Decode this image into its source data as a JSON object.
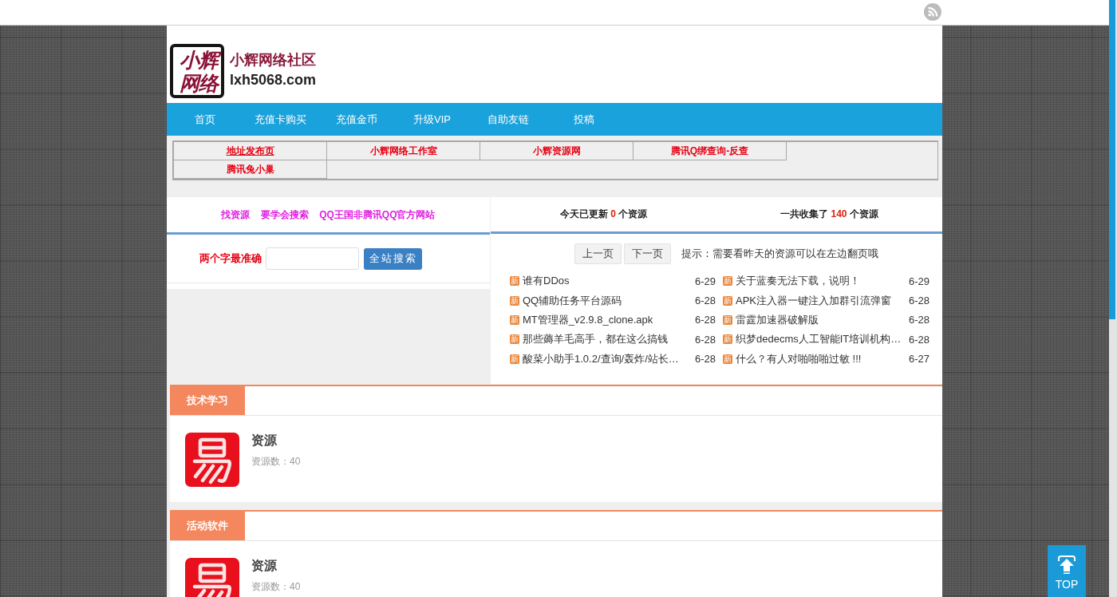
{
  "header": {
    "logo_mark": "小辉网络",
    "site_name": "小辉网络社区",
    "domain": "lxh5068.com"
  },
  "nav": [
    "首页",
    "充值卡购买",
    "充值金币",
    "升级VIP",
    "自助友链",
    "投稿"
  ],
  "link_table": [
    {
      "label": "地址发布页",
      "hovered": true
    },
    {
      "label": "小辉网络工作室",
      "hovered": false
    },
    {
      "label": "小辉资源网",
      "hovered": false
    },
    {
      "label": "腾讯Q绑查询-反查",
      "hovered": false
    },
    {
      "label": "腾讯兔小巢",
      "hovered": false
    }
  ],
  "search_panel": {
    "tips": "找资源 要学会搜索 QQ王国非腾讯QQ官方网站",
    "label": "两个字最准确",
    "button": "全站搜索"
  },
  "latest_panel": {
    "stats": [
      {
        "before": "今天已更新",
        "count": "0",
        "after": "个资源"
      },
      {
        "before": "一共收集了",
        "count": "140",
        "after": "个资源"
      }
    ],
    "pager": {
      "buttons": [
        "上一页",
        "下一页"
      ],
      "hint": "提示：需要看昨天的资源可以在左边翻页哦"
    },
    "items": [
      {
        "badge": "新",
        "title": "谁有DDos",
        "date": "6-29"
      },
      {
        "badge": "新",
        "title": "关于蓝奏无法下载，说明！",
        "date": "6-29"
      },
      {
        "badge": "新",
        "title": "QQ辅助任务平台源码",
        "date": "6-28"
      },
      {
        "badge": "新",
        "title": "APK注入器一键注入加群引流弹窗",
        "date": "6-28"
      },
      {
        "badge": "新",
        "title": "MT管理器_v2.9.8_clone.apk",
        "date": "6-28"
      },
      {
        "badge": "新",
        "title": "雷霆加速器破解版",
        "date": "6-28"
      },
      {
        "badge": "新",
        "title": "那些薅羊毛高手，都在这么搞钱",
        "date": "6-28"
      },
      {
        "badge": "新",
        "title": "织梦dedecms人工智能IT培训机构…",
        "date": "6-28"
      },
      {
        "badge": "新",
        "title": "酸菜小助手1.0.2/查询/轰炸/站长…",
        "date": "6-28"
      },
      {
        "badge": "新",
        "title": "什么？有人对啪啪啪过敏 !!!",
        "date": "6-27"
      }
    ]
  },
  "sections": [
    {
      "title": "技术学习",
      "items": [
        {
          "name": "资源",
          "count": "资源数：40"
        }
      ]
    },
    {
      "title": "活动软件",
      "items": [
        {
          "name": "资源",
          "count": "资源数：40"
        }
      ]
    }
  ],
  "back_to_top": {
    "label": "TOP"
  }
}
